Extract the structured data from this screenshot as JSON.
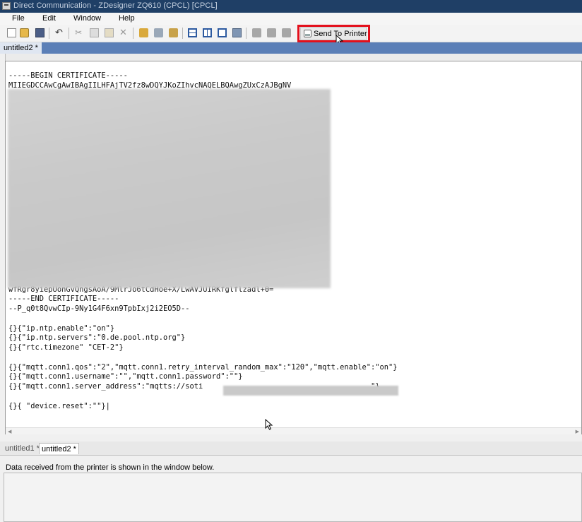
{
  "window": {
    "title": "Direct Communication - ZDesigner ZQ610 (CPCL) [CPCL]"
  },
  "menu": {
    "items": [
      "File",
      "Edit",
      "Window",
      "Help"
    ]
  },
  "toolbar": {
    "send_to_printer_label": "Send To Printer",
    "icons": [
      "new-icon",
      "open-icon",
      "save-icon",
      "undo-icon",
      "cut-icon",
      "copy-icon",
      "paste-icon",
      "delete-icon",
      "send-file-icon",
      "get-status-icon",
      "receive-icon",
      "split-horizontal-icon",
      "split-vertical-icon",
      "single-view-icon",
      "layout-icon",
      "printer-settings-icon",
      "font-icon",
      "download-icon"
    ]
  },
  "document_tab": {
    "label": "untitled2 *"
  },
  "editor": {
    "lines": [
      "-----BEGIN CERTIFICATE-----",
      "MIIEGDCCAwCgAwIBAgIILHFAjTV2fz8wDQYJKoZIhvcNAQELBQAwgZUxCzAJBgNV",
      "",
      "",
      "",
      "",
      "",
      "",
      "",
      "",
      "",
      "",
      "",
      "",
      "",
      "",
      "",
      "",
      "",
      "",
      "",
      "",
      "wfRgr8yiepUonGvQngsAoA/9MlrJo6tCdHoe+X/LwAVJUIRKfglflzadl+0=",
      "-----END CERTIFICATE-----",
      "--P_q0t8QvwCIp-9Ny1G4F6xn9TpbIxj2i2EO5D--",
      "",
      "{}{\"ip.ntp.enable\":\"on\"}",
      "{}{\"ip.ntp.servers\":\"0.de.pool.ntp.org\"}",
      "{}{\"rtc.timezone\" \"CET-2\"}",
      "",
      "{}{\"mqtt.conn1.qos\":\"2\",\"mqtt.conn1.retry_interval_random_max\":\"120\",\"mqtt.enable\":\"on\"}",
      "{}{\"mqtt.conn1.username\":\"\",\"mqtt.conn1.password\":\"\"}",
      "{}{\"mqtt.conn1.server_address\":\"mqtts://soti                                      \"}",
      "",
      "{}{ \"device.reset\":\"\"}|"
    ]
  },
  "bottom_tabs": [
    {
      "label": "untitled1 *",
      "active": false
    },
    {
      "label": "untitled2 *",
      "active": true
    }
  ],
  "output": {
    "info_label": "Data received from the printer is shown in the window below."
  },
  "colors": {
    "title_bar": "#1f3f66",
    "tab_strip": "#5b7fb7",
    "highlight": "#e3101c"
  }
}
